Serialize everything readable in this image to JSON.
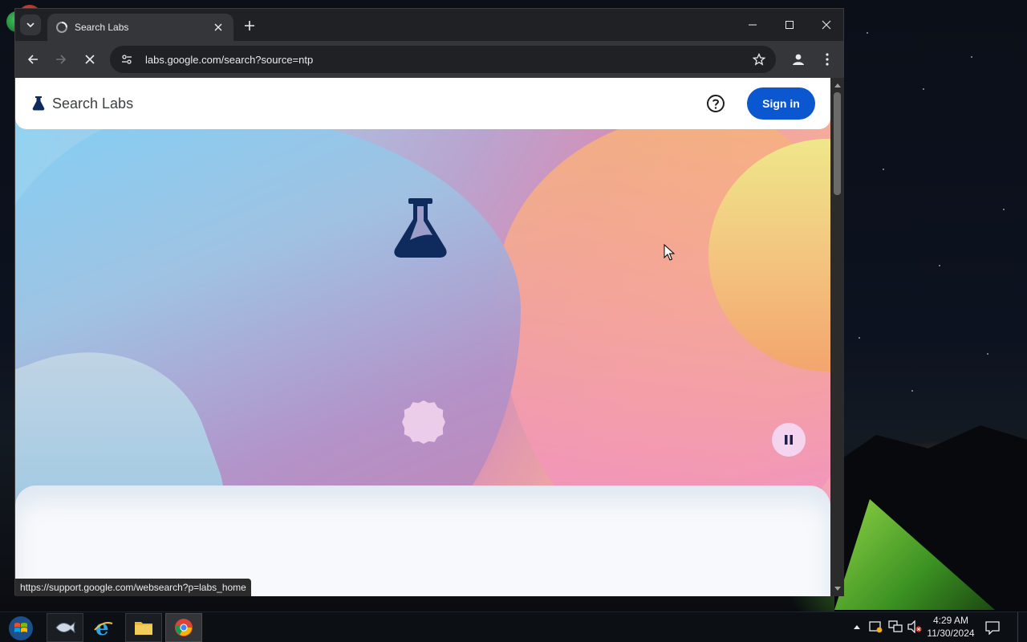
{
  "browser": {
    "tab_title": "Search Labs",
    "url": "labs.google.com/search?source=ntp",
    "status_url": "https://support.google.com/websearch?p=labs_home"
  },
  "page": {
    "brand": "Search Labs",
    "sign_in_label": "Sign in"
  },
  "taskbar": {
    "time": "4:29 AM",
    "date": "11/30/2024"
  },
  "colors": {
    "sign_in_bg": "#0b57d0",
    "flask": "#0f2a5c",
    "browser_frame": "#202124",
    "toolbar": "#35363a"
  }
}
